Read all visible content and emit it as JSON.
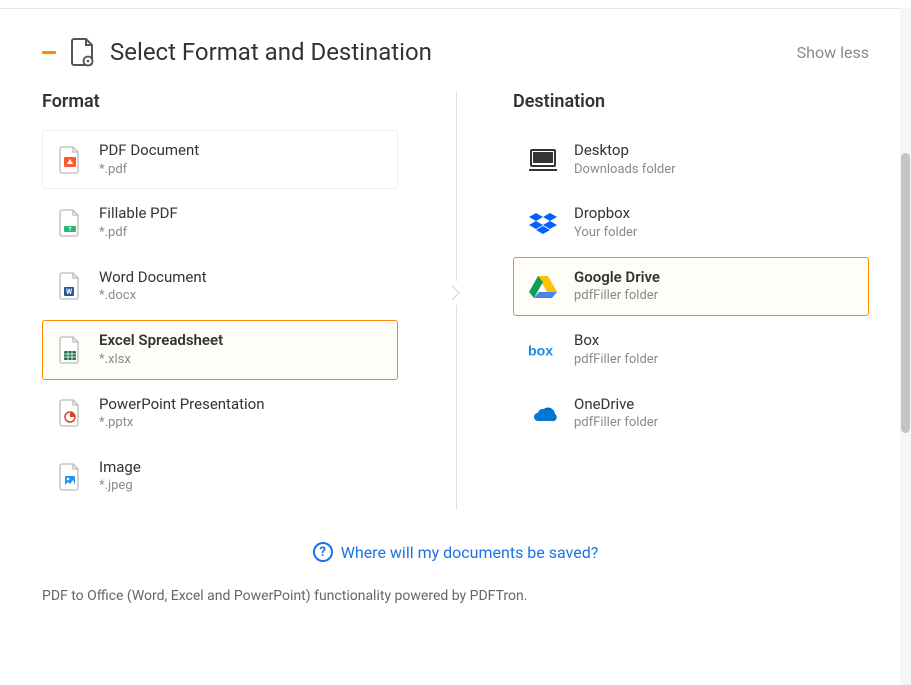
{
  "header": {
    "title": "Select Format and Destination",
    "toggle_label": "Show less"
  },
  "columns": {
    "format_title": "Format",
    "destination_title": "Destination"
  },
  "formats": [
    {
      "title": "PDF Document",
      "sub": "*.pdf",
      "selected": false,
      "icon": "pdf"
    },
    {
      "title": "Fillable PDF",
      "sub": "*.pdf",
      "selected": false,
      "icon": "fillable"
    },
    {
      "title": "Word Document",
      "sub": "*.docx",
      "selected": false,
      "icon": "word"
    },
    {
      "title": "Excel Spreadsheet",
      "sub": "*.xlsx",
      "selected": true,
      "icon": "excel"
    },
    {
      "title": "PowerPoint Presentation",
      "sub": "*.pptx",
      "selected": false,
      "icon": "ppt"
    },
    {
      "title": "Image",
      "sub": "*.jpeg",
      "selected": false,
      "icon": "image"
    }
  ],
  "destinations": [
    {
      "title": "Desktop",
      "sub": "Downloads folder",
      "selected": false,
      "icon": "desktop"
    },
    {
      "title": "Dropbox",
      "sub": "Your folder",
      "selected": false,
      "icon": "dropbox"
    },
    {
      "title": "Google Drive",
      "sub": "pdfFiller folder",
      "selected": true,
      "icon": "gdrive"
    },
    {
      "title": "Box",
      "sub": "pdfFiller folder",
      "selected": false,
      "icon": "box"
    },
    {
      "title": "OneDrive",
      "sub": "pdfFiller folder",
      "selected": false,
      "icon": "onedrive"
    }
  ],
  "help_link": "Where will my documents be saved?",
  "footer_note": "PDF to Office (Word, Excel and PowerPoint) functionality powered by PDFTron."
}
